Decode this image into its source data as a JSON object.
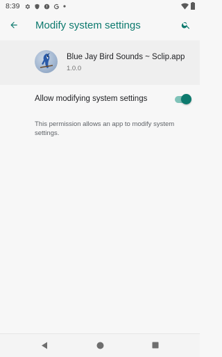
{
  "status_bar": {
    "time": "8:39",
    "left_icons": [
      "gear-icon",
      "shield-icon",
      "alert-icon",
      "google-icon",
      "dot-icon"
    ],
    "right_icons": [
      "wifi-icon",
      "battery-icon"
    ]
  },
  "app_bar": {
    "title": "Modify system settings",
    "back_icon": "arrow-back-icon",
    "search_icon": "search-icon"
  },
  "app_header": {
    "name": "Blue Jay Bird Sounds ~ Sclip.app",
    "version": "1.0.0"
  },
  "setting": {
    "label": "Allow modifying system settings",
    "enabled": true
  },
  "description": "This permission allows an app to modify system settings.",
  "nav_bar": {
    "buttons": [
      "back-triangle-icon",
      "home-circle-icon",
      "recents-square-icon"
    ]
  },
  "colors": {
    "accent": "#0d7a6e",
    "switch_track": "#80c3b9",
    "background": "#f7f7f7"
  }
}
